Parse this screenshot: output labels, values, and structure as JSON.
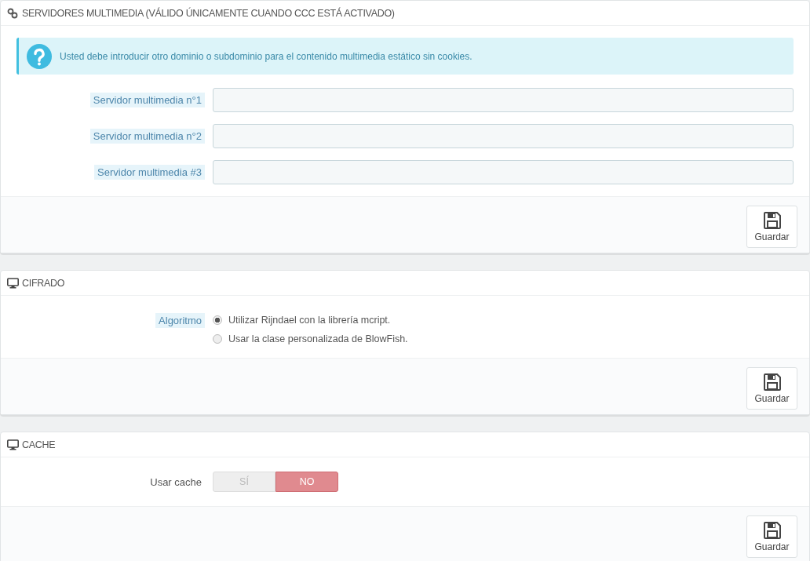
{
  "panels": [
    {
      "kind": "link",
      "title": "SERVIDORES MULTIMEDIA (VÁLIDO ÚNICAMENTE CUANDO CCC ESTÁ ACTIVADO)",
      "alert": {
        "text": "Usted debe introducir otro dominio o subdominio para el contenido multimedia estático sin cookies."
      },
      "fields": [
        {
          "kind": "text",
          "label": "Servidor multimedia n°1",
          "highlighted": true
        },
        {
          "kind": "text",
          "label": "Servidor multimedia n°2",
          "highlighted": true
        },
        {
          "kind": "text",
          "label": "Servidor multimedia #3",
          "highlighted": true
        }
      ],
      "save_button": "Guardar"
    },
    {
      "kind": "monitor",
      "title": "CIFRADO",
      "fields": [
        {
          "kind": "radio",
          "label": "Algoritmo",
          "highlighted": true,
          "options": [
            {
              "label": "Utilizar Rijndael con la librería mcript.",
              "selected": true
            },
            {
              "label": "Usar la clase personalizada de BlowFish.",
              "selected": false
            }
          ]
        }
      ],
      "save_button": "Guardar"
    },
    {
      "kind": "monitor",
      "title": "CACHE",
      "fields": [
        {
          "kind": "switch",
          "label": "Usar cache",
          "highlighted": false,
          "options": [
            {
              "label": "SÍ",
              "selected": false
            },
            {
              "label": "NO",
              "selected": true
            }
          ]
        }
      ],
      "save_button": "Guardar"
    }
  ]
}
